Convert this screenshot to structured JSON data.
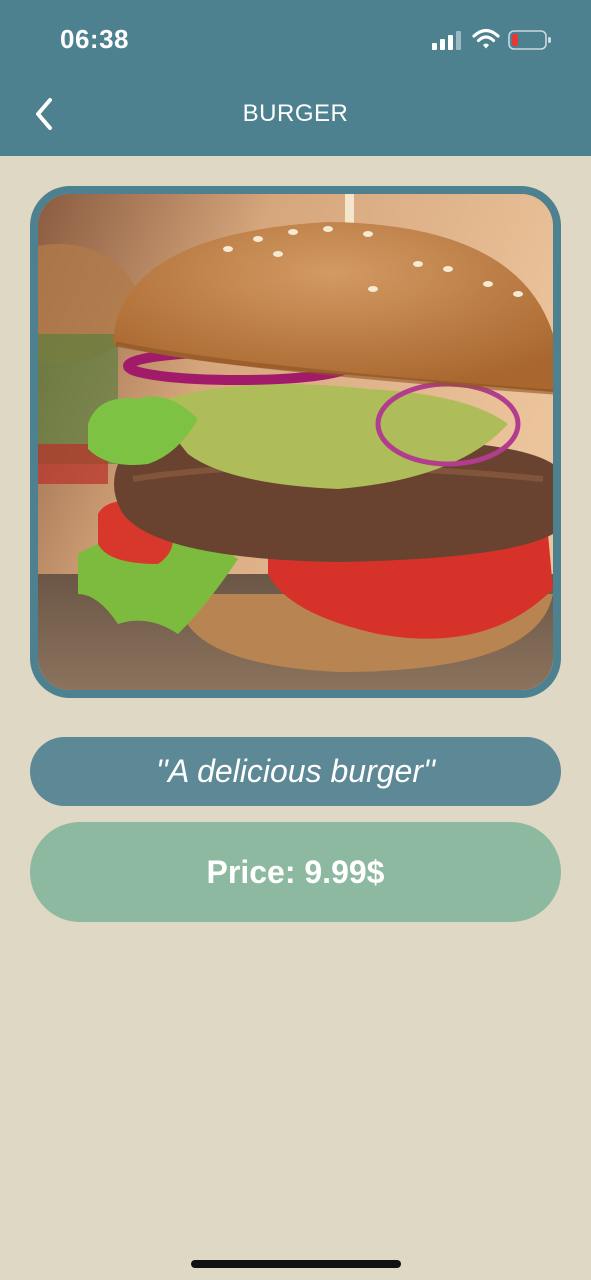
{
  "status_bar": {
    "time": "06:38",
    "icons": [
      "cellular-signal-icon",
      "wifi-icon",
      "battery-low-icon"
    ],
    "battery_color": "#e53935"
  },
  "header": {
    "title": "BURGER",
    "back_icon": "chevron-left-icon",
    "background": "#4d8190"
  },
  "product": {
    "image_subject": "burger",
    "description": "''A delicious burger''",
    "price_text": "Price: 9.99$"
  },
  "colors": {
    "page_background": "#dfd8c5",
    "frame_border": "#4d8190",
    "description_pill": "#5d8896",
    "price_pill": "#8db9a1"
  }
}
